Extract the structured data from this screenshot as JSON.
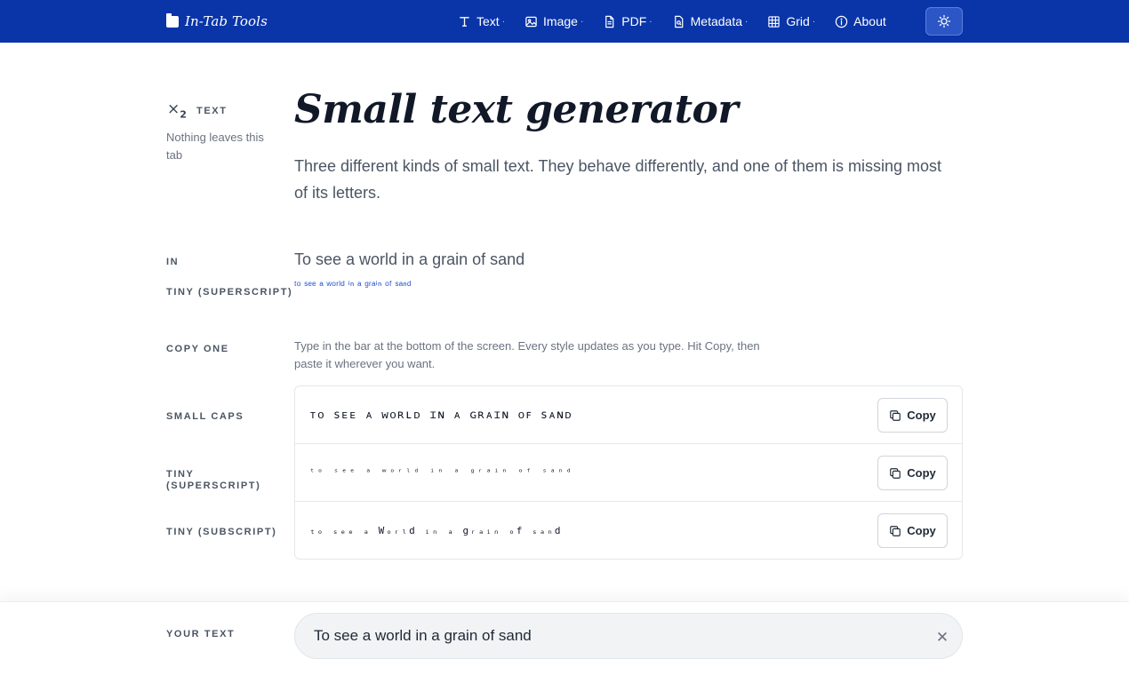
{
  "brand": {
    "name": "In-Tab Tools"
  },
  "nav": {
    "items": [
      {
        "label": "Text",
        "icon": "text-icon",
        "has_menu": true
      },
      {
        "label": "Image",
        "icon": "image-icon",
        "has_menu": true
      },
      {
        "label": "PDF",
        "icon": "pdf-icon",
        "has_menu": true
      },
      {
        "label": "Metadata",
        "icon": "metadata-icon",
        "has_menu": true
      },
      {
        "label": "Grid",
        "icon": "grid-icon",
        "has_menu": true
      },
      {
        "label": "About",
        "icon": "info-icon",
        "has_menu": false
      }
    ],
    "caret": "·",
    "theme_toggle_icon": "sun-icon"
  },
  "category": {
    "icon_text": "×",
    "icon_sub": "2",
    "label": "TEXT",
    "note": "Nothing leaves this tab"
  },
  "header": {
    "title": "Small text generator",
    "intro": "Three different kinds of small text. They behave differently, and one of them is missing most of its letters."
  },
  "preview": {
    "in_label": "IN",
    "in_text": "To see a world in a grain of sand",
    "tiny_label": "TINY (SUPERSCRIPT)",
    "tiny_text": "ᵗᵒ ˢᵉᵉ ᵃ ʷᵒʳˡᵈ ⁱⁿ ᵃ ᵍʳᵃⁱⁿ ᵒᶠ ˢᵃⁿᵈ"
  },
  "copy_section": {
    "label": "COPY ONE",
    "hint": "Type in the bar at the bottom of the screen. Every style updates as you type. Hit Copy, then paste it wherever you want."
  },
  "results": [
    {
      "label": "SMALL CAPS",
      "text": "ᴛᴏ sᴇᴇ ᴀ ᴡᴏʀʟᴅ ɪɴ ᴀ ɢʀᴀɪɴ ᴏꜰ sᴀɴᴅ",
      "button": "Copy"
    },
    {
      "label": "TINY (SUPERSCRIPT)",
      "text": "ᵗᵒ ˢᵉᵉ ᵃ ʷᵒʳˡᵈ ⁱⁿ ᵃ ᵍʳᵃⁱⁿ ᵒᶠ ˢᵃⁿᵈ",
      "button": "Copy"
    },
    {
      "label": "TINY (SUBSCRIPT)",
      "text": "ₜₒ ₛₑₑ ₐ Wₒᵣₗd ᵢₙ ₐ gᵣₐᵢₙ ₒf ₛₐₙd",
      "button": "Copy"
    }
  ],
  "input_bar": {
    "label": "YOUR TEXT",
    "value": "To see a world in a grain of sand",
    "clear_icon": "close-icon"
  },
  "colors": {
    "nav_background": "#0a35a8",
    "accent": "#1d4ed8",
    "input_background": "#f1f3f5"
  }
}
